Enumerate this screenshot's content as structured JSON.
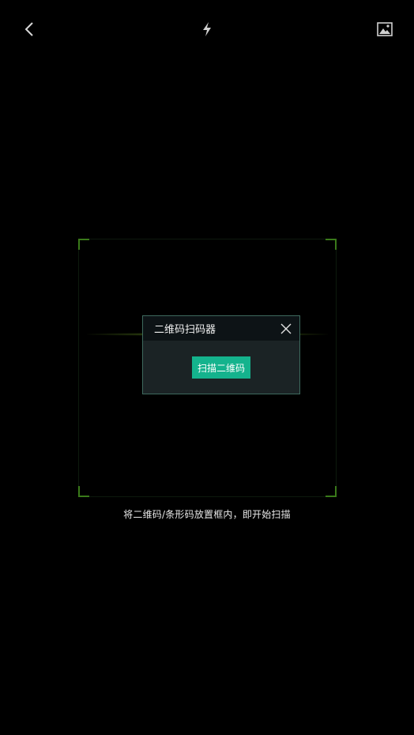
{
  "topbar": {
    "back_icon": "chevron-left-icon",
    "flash_icon": "flash-icon",
    "gallery_icon": "image-gallery-icon"
  },
  "scanner": {
    "hint": "将二维码/条形码放置框内，即开始扫描",
    "accent_color": "#3a7a1a"
  },
  "dialog": {
    "title": "二维码扫码器",
    "close_icon": "close-icon",
    "button_label": "扫描二维码",
    "button_color": "#14b38d"
  }
}
